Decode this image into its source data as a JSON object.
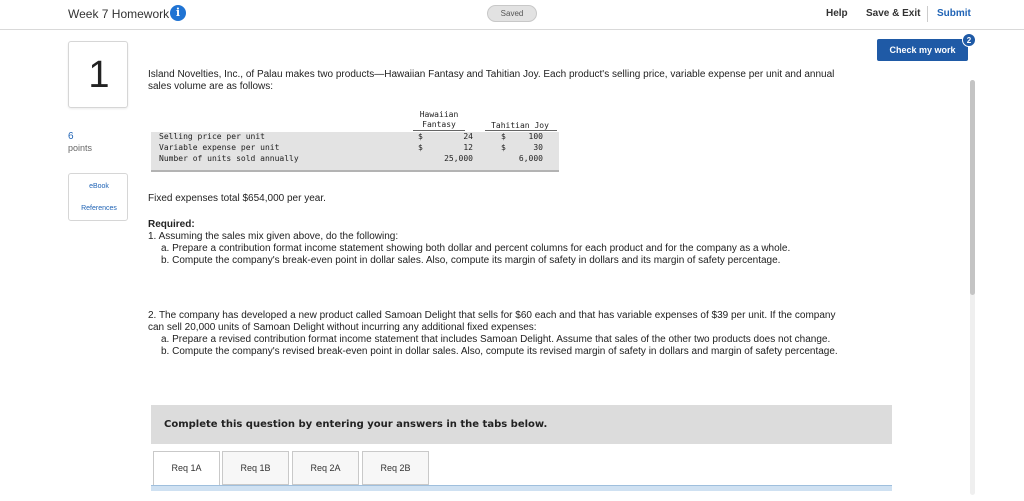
{
  "header": {
    "assignment_title": "Week 7 Homework",
    "info_glyph": "i",
    "saved_status": "Saved",
    "help_label": "Help",
    "save_exit_label": "Save & Exit",
    "submit_label": "Submit"
  },
  "check_work": {
    "label": "Check my work",
    "badge_count": "2"
  },
  "question": {
    "number": "1",
    "points_value": "6",
    "points_label": "points",
    "ebook_label": "eBook",
    "references_label": "References"
  },
  "problem": {
    "intro": "Island Novelties, Inc., of Palau makes two products—Hawaiian Fantasy and Tahitian Joy. Each product's selling price, variable expense per unit and annual sales volume are as follows:",
    "table": {
      "header_a_line1": "Hawaiian",
      "header_a_line2": "Fantasy",
      "header_b": "Tahitian Joy",
      "rows": [
        {
          "label": "Selling price per unit",
          "a_sign": "$",
          "a_value": "24",
          "b_sign": "$",
          "b_value": "100"
        },
        {
          "label": "Variable expense per unit",
          "a_sign": "$",
          "a_value": "12",
          "b_sign": "$",
          "b_value": "30"
        },
        {
          "label": "Number of units sold annually",
          "a_sign": "",
          "a_value": "25,000",
          "b_sign": "",
          "b_value": "6,000"
        }
      ]
    },
    "fixed_expenses": "Fixed expenses total $654,000 per year.",
    "required_heading": "Required:",
    "req1": "1. Assuming the sales mix given above, do the following:",
    "req1a": "a. Prepare a contribution format income statement showing both dollar and percent columns for each product and for the company as a whole.",
    "req1b": "b. Compute the company's break-even point in dollar sales. Also, compute its margin of safety in dollars and its margin of safety percentage.",
    "req2": "2. The company has developed a new product called Samoan Delight that sells for $60 each and that has variable expenses of $39 per unit. If the company can sell 20,000 units of Samoan Delight without incurring any additional fixed expenses:",
    "req2a": "a. Prepare a revised contribution format income statement that includes Samoan Delight. Assume that sales of the other two products does not change.",
    "req2b": "b. Compute the company's revised break-even point in dollar sales. Also, compute its revised margin of safety in dollars and margin of safety percentage."
  },
  "banner": {
    "text": "Complete this question by entering your answers in the tabs below."
  },
  "tabs": [
    {
      "label": "Req 1A"
    },
    {
      "label": "Req 1B"
    },
    {
      "label": "Req 2A"
    },
    {
      "label": "Req 2B"
    }
  ],
  "colors": {
    "accent": "#1f5aa6",
    "link": "#1f63b5",
    "banner_bg": "#dcdcdc"
  }
}
